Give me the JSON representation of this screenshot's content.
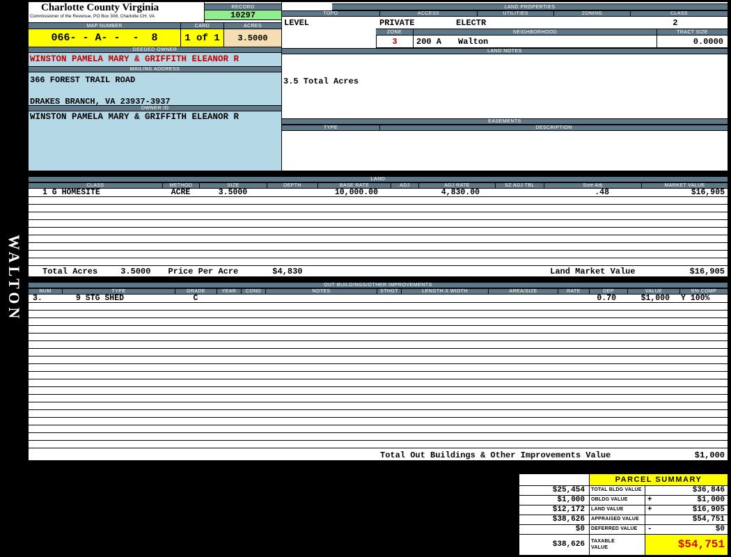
{
  "colors": {
    "header_bar": "#5d7889",
    "panel_blue": "#b5d8e6",
    "record_green": "#90ee90",
    "highlight_yellow": "#ffff00",
    "acres_tan": "#f5deb3",
    "owner_red": "#c00000",
    "taxable_red": "#dd0000"
  },
  "sidebar": {
    "vertical_label": "WALTON"
  },
  "header": {
    "county_title": "Charlotte County Virginia",
    "commissioner_line": "Commissioner of the Revenue, PO Box 308, Charlotte CH, VA",
    "record_label": "RECORD",
    "record_value": "10297",
    "map_number_label": "MAP NUMBER",
    "map_number_value": "066- - A- -  -  8",
    "card_label": "CARD",
    "card_value": "1 of 1",
    "acres_label": "ACRES",
    "acres_value": "3.5000"
  },
  "owner": {
    "deeded_owner_label": "DEEDED OWNER",
    "deeded_owner": "WINSTON PAMELA MARY & GRIFFITH ELEANOR R",
    "mailing_address_label": "MAILING ADDRESS",
    "address_line1": "366 FOREST TRAIL ROAD",
    "address_line2": "DRAKES BRANCH, VA 23937-3937",
    "owner_id_label": "OWNER ID",
    "owner_id": "WINSTON PAMELA MARY & GRIFFITH ELEANOR R"
  },
  "land_properties": {
    "section_label": "LAND PROPERTIES",
    "headers": [
      "TOPO",
      "ACCESS",
      "UTILITIES",
      "ZONING",
      "CLASS"
    ],
    "topo": "LEVEL",
    "access": "PRIVATE",
    "utilities": "ELECTR",
    "zoning": "",
    "class": "2",
    "zone_label": "ZONE",
    "zone_value": "3",
    "neighborhood_label": "NEIGHBORHOOD",
    "neighborhood_code": "200 A",
    "neighborhood_value": "Walton",
    "tract_size_label": "TRACT SIZE",
    "tract_size_value": "0.0000"
  },
  "land_notes": {
    "section_label": "LAND NOTES",
    "note": "3.5 Total Acres"
  },
  "easements": {
    "section_label": "EASEMENTS",
    "type_label": "TYPE",
    "description_label": "DESCRIPTION"
  },
  "land": {
    "section_label": "LAND",
    "columns": [
      "CLASS",
      "METHOD",
      "SIZE",
      "DEPTH",
      "BASE RATE",
      "ADJ",
      "ADJ RATE",
      "SZ ADJ TBL",
      "Size Adj",
      "MARKET VALUE"
    ],
    "rows": [
      {
        "class": "1 G HOMESITE",
        "method": "ACRE",
        "size": "3.5000",
        "depth": "",
        "base_rate": "10,000.00",
        "adj": "",
        "adj_rate": "4,830.00",
        "sz_adj_tbl": "",
        "size_adj": ".48",
        "market_value": "$16,905"
      }
    ],
    "totals": {
      "total_acres_label": "Total Acres",
      "total_acres": "3.5000",
      "price_per_acre_label": "Price Per Acre",
      "price_per_acre": "$4,830",
      "land_market_value_label": "Land Market Value",
      "land_market_value": "$16,905"
    }
  },
  "out_buildings": {
    "section_label": "OUT BUILDINGS/OTHER IMPROVEMENTS",
    "columns": [
      "NUM",
      "TYPE",
      "GRADE",
      "YEAR",
      "COND",
      "NOTES",
      "STHGT",
      "LENGTH X WIDTH",
      "AREA/SIZE",
      "RATE",
      "DEP",
      "VALUE",
      "S% COMP"
    ],
    "rows": [
      {
        "num": "3.",
        "type": "9 STG SHED",
        "grade": "C",
        "year": "",
        "cond": "",
        "notes": "",
        "sthgt": "",
        "length_x_width": "",
        "area_size": "",
        "rate": "",
        "dep": "0.70",
        "value": "$1,000",
        "s_comp": "Y 100%"
      }
    ],
    "total_label": "Total Out Buildings & Other Improvements Value",
    "total_value": "$1,000"
  },
  "parcel_summary": {
    "title": "PARCEL SUMMARY",
    "rows": [
      {
        "prior": "$25,454",
        "label": "TOTAL BLDG VALUE",
        "sign": "",
        "value": "$36,846"
      },
      {
        "prior": "$1,000",
        "label": "OBLDG VALUE",
        "sign": "+",
        "value": "$1,000"
      },
      {
        "prior": "$12,172",
        "label": "LAND VALUE",
        "sign": "+",
        "value": "$16,905"
      },
      {
        "prior": "$38,626",
        "label": "APPRAISED VALUE",
        "sign": "",
        "value": "$54,751"
      },
      {
        "prior": "$0",
        "label": "DEFERRED VALUE",
        "sign": "-",
        "value": "$0"
      },
      {
        "prior": "$38,626",
        "label": "TAXABLE VALUE",
        "sign": "",
        "value": "$54,751"
      }
    ]
  }
}
